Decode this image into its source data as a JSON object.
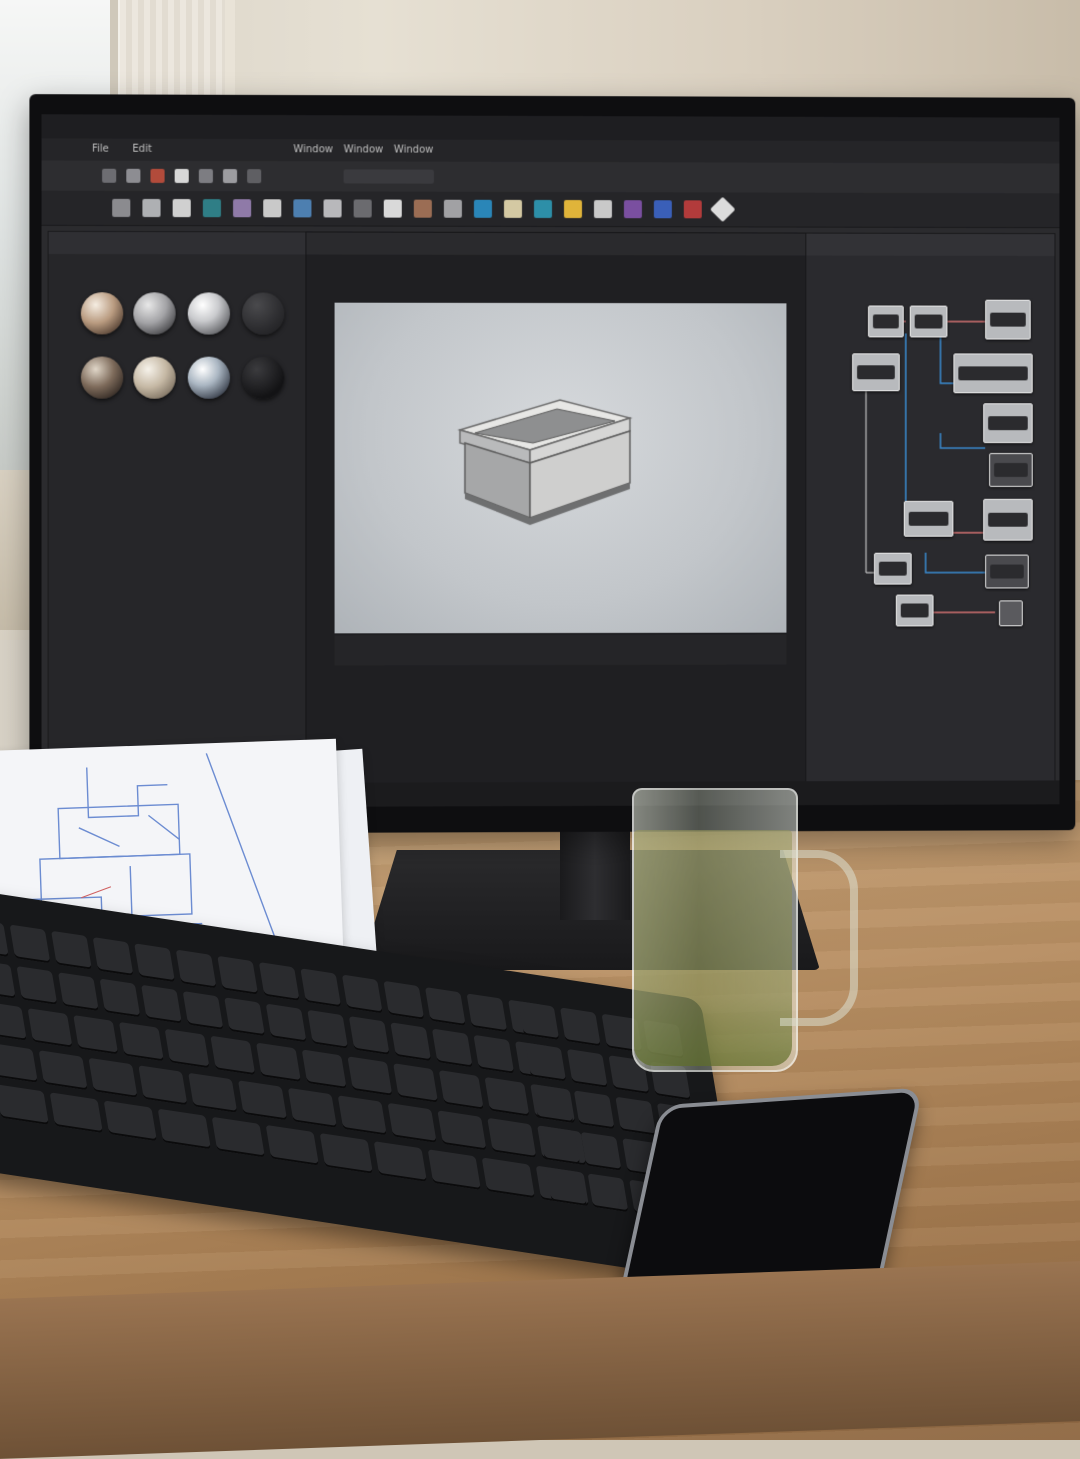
{
  "scene": "workstation",
  "app": {
    "menus": [
      "File",
      "Edit",
      "Window",
      "Window",
      "Window"
    ],
    "node_labels": [
      "",
      "",
      "",
      "",
      "",
      "",
      "",
      "",
      "",
      "",
      "",
      ""
    ]
  },
  "colors": {
    "ui_background": "#2b2b2e",
    "viewport": "#c8ccd0",
    "desk": "#b88f63",
    "tea": "#7a8440"
  }
}
